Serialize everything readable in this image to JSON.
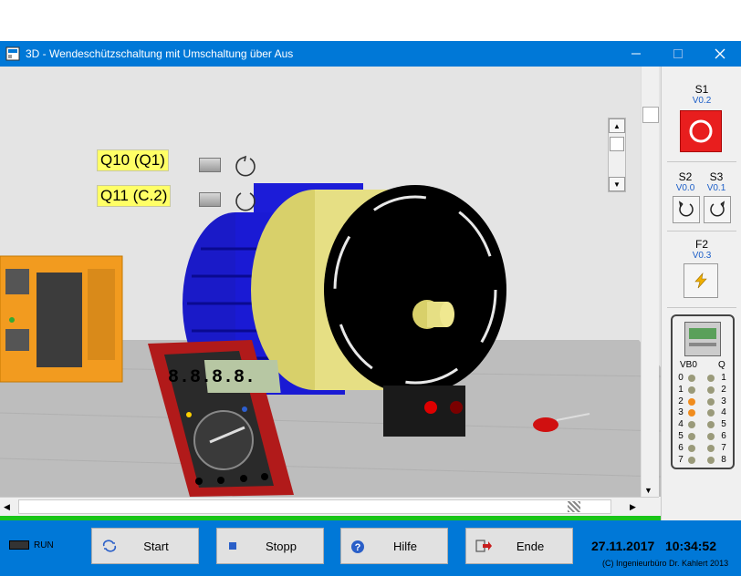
{
  "window": {
    "title": "3D - Wendeschützschaltung mit Umschaltung über Aus"
  },
  "scene": {
    "labels": [
      {
        "id": "q10",
        "text": "Q10 (Q1)"
      },
      {
        "id": "q11",
        "text": "Q11 (C.2)"
      }
    ],
    "multimeter_display": "8.8.8.8."
  },
  "side_panel": {
    "s1": {
      "label": "S1",
      "address": "V0.2"
    },
    "s2": {
      "label": "S2",
      "address": "V0.0"
    },
    "s3": {
      "label": "S3",
      "address": "V0.1"
    },
    "f2": {
      "label": "F2",
      "address": "V0.3"
    },
    "io": {
      "header_in": "VB0",
      "header_out": "Q",
      "inputs": [
        "0",
        "1",
        "2",
        "3",
        "4",
        "5",
        "6",
        "7"
      ],
      "outputs": [
        "1",
        "2",
        "3",
        "4",
        "5",
        "6",
        "7",
        "8"
      ],
      "input_states": [
        "off",
        "off",
        "on",
        "on",
        "off",
        "off",
        "off",
        "off"
      ],
      "output_states": [
        "off",
        "off",
        "off",
        "off",
        "off",
        "off",
        "off",
        "off"
      ]
    }
  },
  "bottom_bar": {
    "run_label": "RUN",
    "buttons": {
      "start": "Start",
      "stop": "Stopp",
      "help": "Hilfe",
      "end": "Ende"
    },
    "datetime": "27.11.2017   10:34:52",
    "copyright": "(C) Ingenieurbüro Dr. Kahlert 2013"
  },
  "colors": {
    "accent": "#0078d7",
    "status_green": "#19c519",
    "label_yellow": "#ffff66",
    "led_on": "#f08c1e",
    "led_off": "#9a9a7a"
  }
}
